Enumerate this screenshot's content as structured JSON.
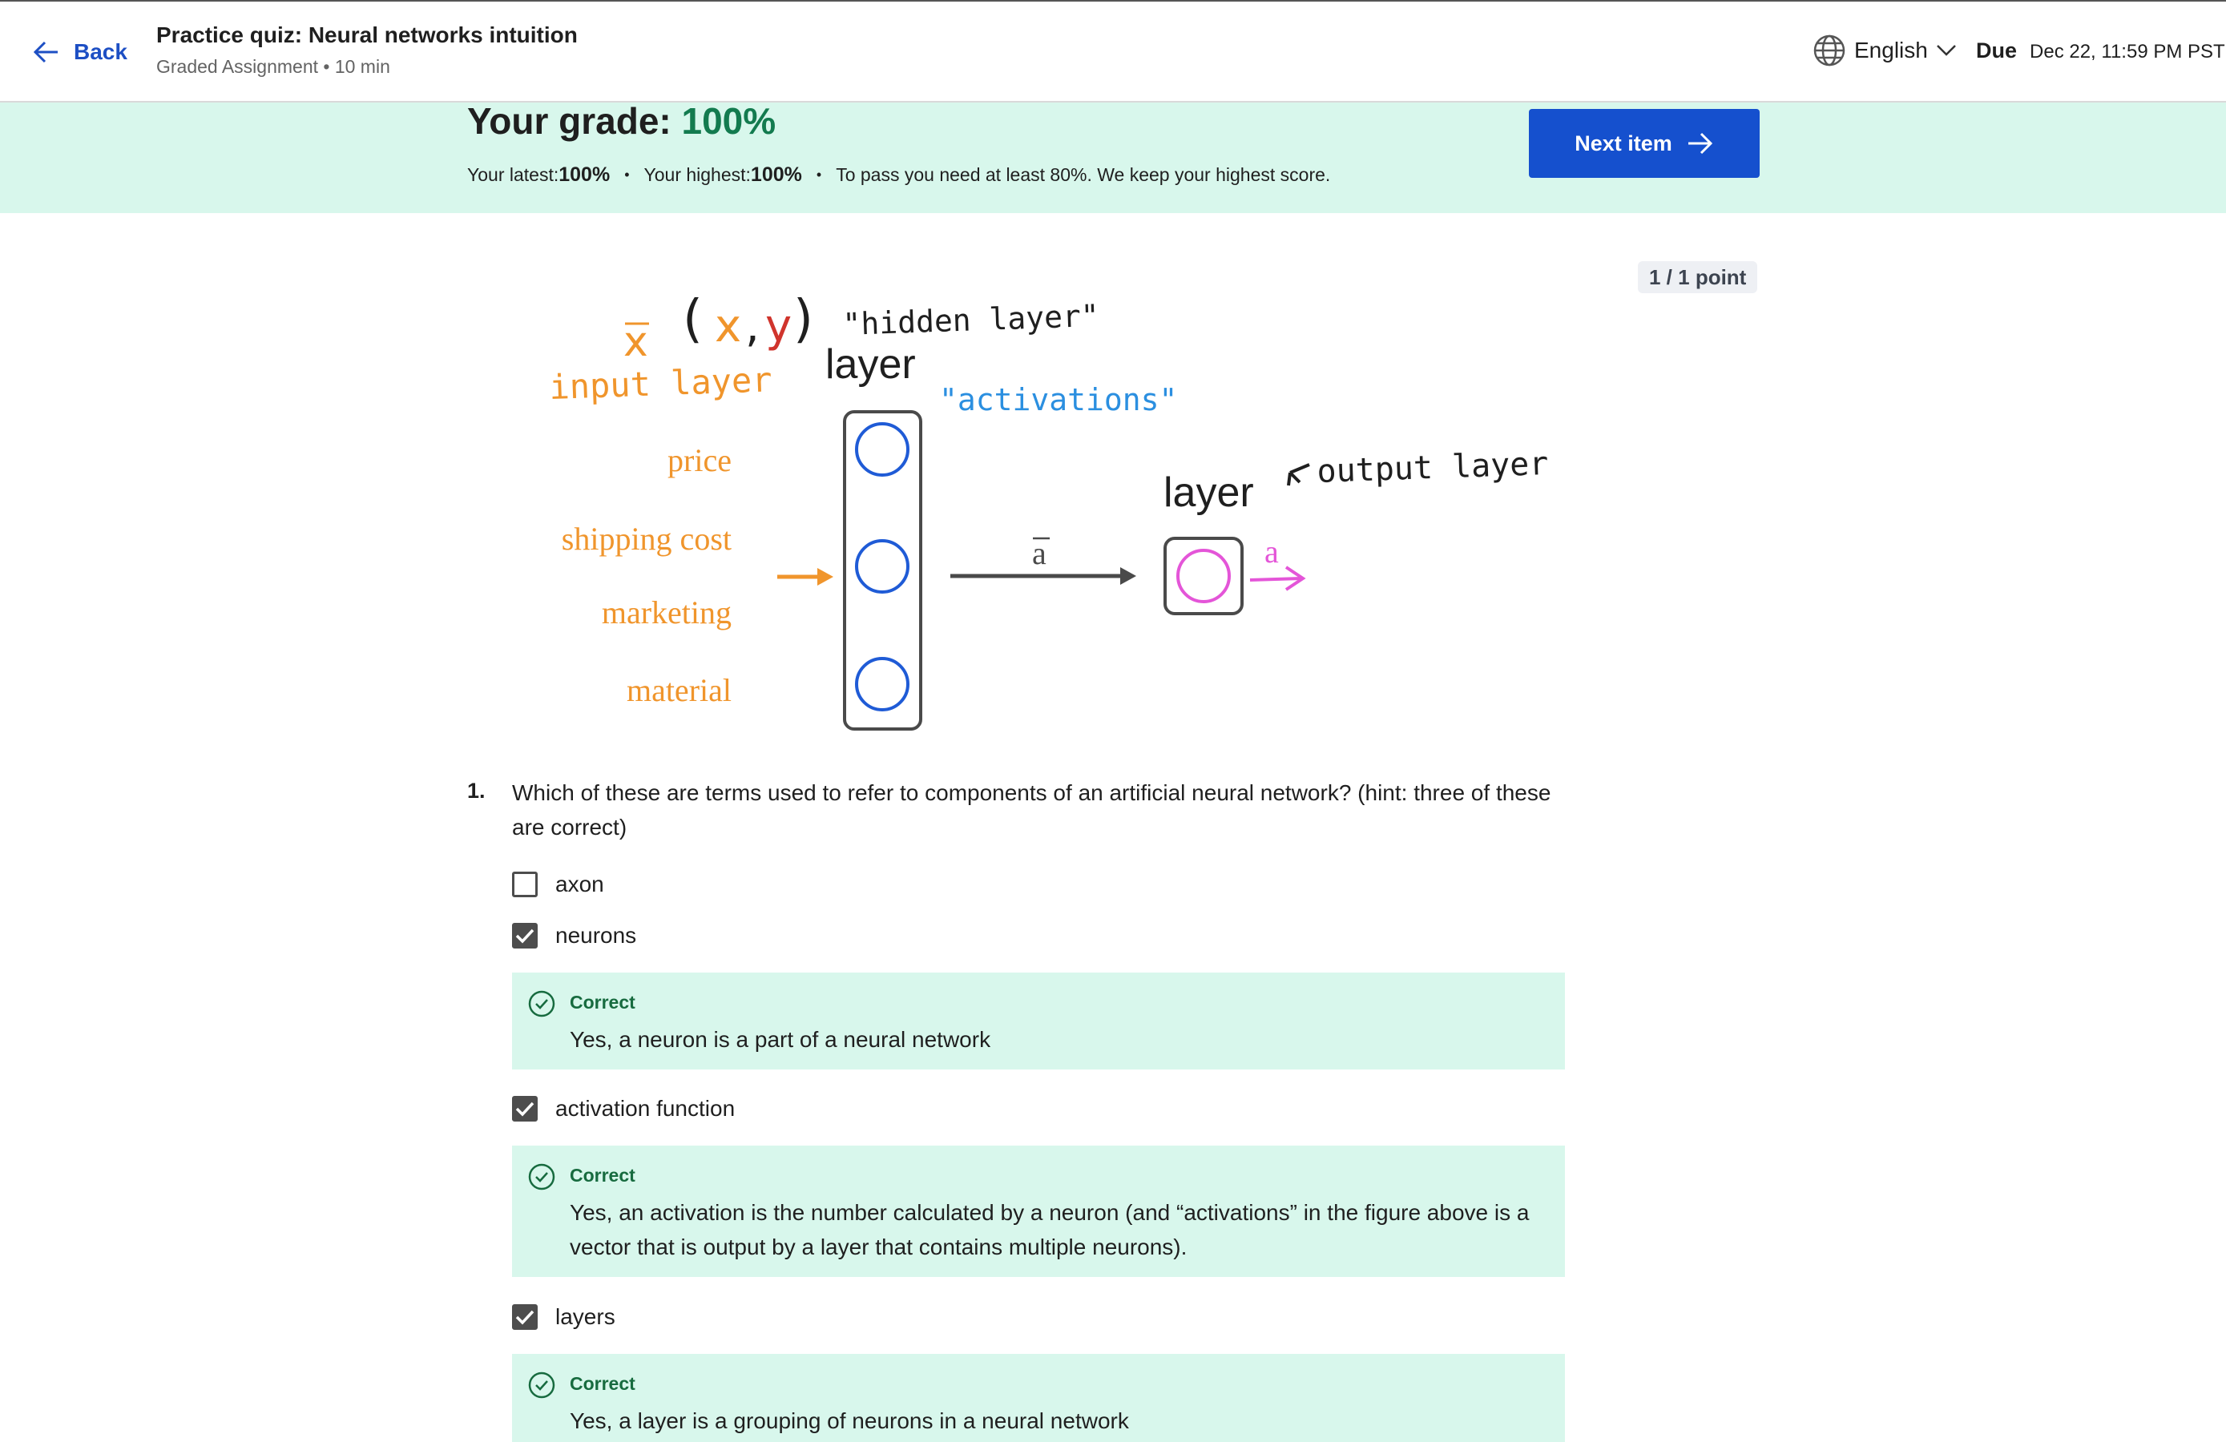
{
  "header": {
    "back_label": "Back",
    "title": "Practice quiz: Neural networks intuition",
    "subtitle": "Graded Assignment • 10 min",
    "language": "English",
    "due_label": "Due",
    "due_value": "Dec 22, 11:59 PM PST"
  },
  "grade": {
    "title_prefix": "Your grade: ",
    "title_value": "100%",
    "latest_label": "Your latest: ",
    "latest_value": "100%",
    "highest_label": "Your highest: ",
    "highest_value": "100%",
    "pass_note": "To pass you need at least 80%. We keep your highest score.",
    "next_button": "Next item"
  },
  "question": {
    "points": "1 / 1 point",
    "number": "1.",
    "text": "Which of these are terms used to refer to components of an artificial neural network? (hint: three of these are correct)",
    "options": [
      {
        "label": "axon",
        "checked": false
      },
      {
        "label": "neurons",
        "checked": true,
        "feedback_label": "Correct",
        "feedback": "Yes, a neuron is a part of a neural network"
      },
      {
        "label": "activation function",
        "checked": true,
        "feedback_label": "Correct",
        "feedback": "Yes, an activation is the number calculated by a neuron (and “activations” in the figure above is a vector that is output by a layer that contains multiple neurons)."
      },
      {
        "label": "layers",
        "checked": true,
        "feedback_label": "Correct",
        "feedback": "Yes, a layer is a grouping of neurons in a neural network"
      }
    ]
  },
  "figure": {
    "x_vec": "x",
    "open_paren": "(",
    "x": "x",
    "comma": ",",
    "y": "y",
    "close_paren": ")",
    "hidden_layer": "\"hidden layer\"",
    "layer_hidden": "layer",
    "input_layer": "input layer",
    "activations": "\"activations\"",
    "inputs": [
      "price",
      "shipping cost",
      "marketing",
      "material"
    ],
    "a_vec": "a",
    "layer_output": "layer",
    "output_layer": "output layer",
    "a_out": "a",
    "colors": {
      "orange": "#f0952c",
      "blue": "#2b8fe0",
      "red": "#d0342c",
      "magenta": "#e455d8",
      "neuron_blue": "#1f5bd6",
      "dark": "#4a4a4a"
    }
  },
  "icons": {
    "back": "arrow-left-icon",
    "globe": "globe-icon",
    "chevron": "chevron-down-icon",
    "next": "arrow-right-icon",
    "check": "checkmark-icon",
    "correct": "check-circle-icon"
  }
}
